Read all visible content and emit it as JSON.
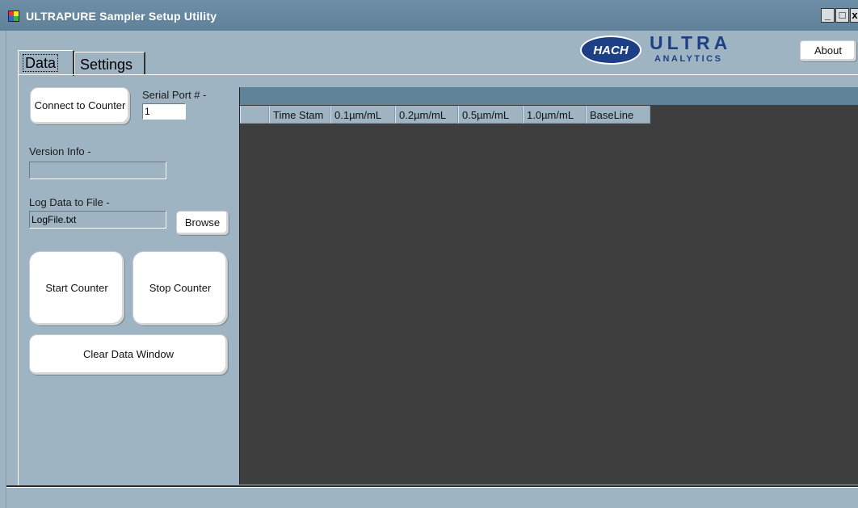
{
  "window": {
    "title": "ULTRAPURE Sampler Setup Utility",
    "controls": [
      "_",
      "□",
      "x"
    ]
  },
  "logo": {
    "brand": "HACH",
    "line1": "ULTRA",
    "line2": "ANALYTICS"
  },
  "header": {
    "about_label": "About"
  },
  "tabs": [
    {
      "label": "Data",
      "active": true
    },
    {
      "label": "Settings",
      "active": false
    }
  ],
  "controls": {
    "connect_label": "Connect to Counter",
    "serial_port_label": "Serial Port # -",
    "serial_port_value": "1",
    "version_label": "Version Info -",
    "version_value": "",
    "log_label": "Log Data to File -",
    "log_value": "LogFile.txt",
    "browse_label": "Browse",
    "start_label": "Start Counter",
    "stop_label": "Stop Counter",
    "clear_label": "Clear Data Window"
  },
  "grid": {
    "columns": [
      "Time Stam",
      "0.1µm/mL",
      "0.2µm/mL",
      "0.5µm/mL",
      "1.0µm/mL",
      "BaseLine"
    ]
  },
  "colors": {
    "background": "#9fb4c3",
    "titlebar": "#6e8ea6",
    "grid_body": "#3e3e3e",
    "brand_blue": "#1d3f86"
  }
}
